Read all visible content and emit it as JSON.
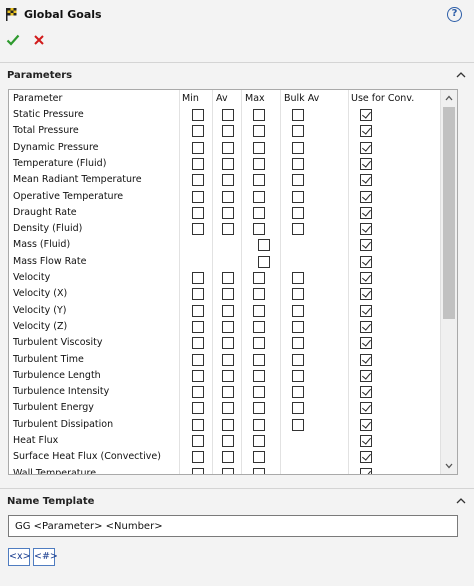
{
  "header": {
    "title": "Global Goals",
    "help_label": "?"
  },
  "sections": {
    "parameters": "Parameters",
    "name_template": "Name Template"
  },
  "columns": [
    "Parameter",
    "Min",
    "Av",
    "Max",
    "Bulk Av",
    "Use for Conv."
  ],
  "rows": [
    {
      "name": "Static Pressure",
      "min": false,
      "av": false,
      "max": false,
      "bulk": false,
      "conv": true
    },
    {
      "name": "Total Pressure",
      "min": false,
      "av": false,
      "max": false,
      "bulk": false,
      "conv": true
    },
    {
      "name": "Dynamic Pressure",
      "min": false,
      "av": false,
      "max": false,
      "bulk": false,
      "conv": true
    },
    {
      "name": "Temperature (Fluid)",
      "min": false,
      "av": false,
      "max": false,
      "bulk": false,
      "conv": true
    },
    {
      "name": "Mean Radiant Temperature",
      "min": false,
      "av": false,
      "max": false,
      "bulk": false,
      "conv": true
    },
    {
      "name": "Operative Temperature",
      "min": false,
      "av": false,
      "max": false,
      "bulk": false,
      "conv": true
    },
    {
      "name": "Draught Rate",
      "min": false,
      "av": false,
      "max": false,
      "bulk": false,
      "conv": true
    },
    {
      "name": "Density (Fluid)",
      "min": false,
      "av": false,
      "max": false,
      "bulk": false,
      "conv": true
    },
    {
      "name": "Mass (Fluid)",
      "single": true,
      "value": false,
      "conv": true
    },
    {
      "name": "Mass Flow Rate",
      "single": true,
      "value": false,
      "conv": true
    },
    {
      "name": "Velocity",
      "min": false,
      "av": false,
      "max": false,
      "bulk": false,
      "conv": true
    },
    {
      "name": "Velocity (X)",
      "min": false,
      "av": false,
      "max": false,
      "bulk": false,
      "conv": true
    },
    {
      "name": "Velocity (Y)",
      "min": false,
      "av": false,
      "max": false,
      "bulk": false,
      "conv": true
    },
    {
      "name": "Velocity (Z)",
      "min": false,
      "av": false,
      "max": false,
      "bulk": false,
      "conv": true
    },
    {
      "name": "Turbulent Viscosity",
      "min": false,
      "av": false,
      "max": false,
      "bulk": false,
      "conv": true
    },
    {
      "name": "Turbulent Time",
      "min": false,
      "av": false,
      "max": false,
      "bulk": false,
      "conv": true
    },
    {
      "name": "Turbulence Length",
      "min": false,
      "av": false,
      "max": false,
      "bulk": false,
      "conv": true
    },
    {
      "name": "Turbulence Intensity",
      "min": false,
      "av": false,
      "max": false,
      "bulk": false,
      "conv": true
    },
    {
      "name": "Turbulent Energy",
      "min": false,
      "av": false,
      "max": false,
      "bulk": false,
      "conv": true
    },
    {
      "name": "Turbulent Dissipation",
      "min": false,
      "av": false,
      "max": false,
      "bulk": false,
      "conv": true
    },
    {
      "name": "Heat Flux",
      "min": false,
      "av": false,
      "max": false,
      "bulk": null,
      "conv": true
    },
    {
      "name": "Surface Heat Flux (Convective)",
      "min": false,
      "av": false,
      "max": false,
      "bulk": null,
      "conv": true
    },
    {
      "name": "Wall Temperature",
      "min": false,
      "av": false,
      "max": false,
      "bulk": null,
      "conv": true
    }
  ],
  "name_template": {
    "value": "GG <Parameter> <Number>"
  },
  "tokens": [
    "<x>",
    "<#>"
  ],
  "colors": {
    "accent": "#2d5ea8",
    "ok": "#2e9a2e",
    "cancel": "#d11a1a"
  }
}
